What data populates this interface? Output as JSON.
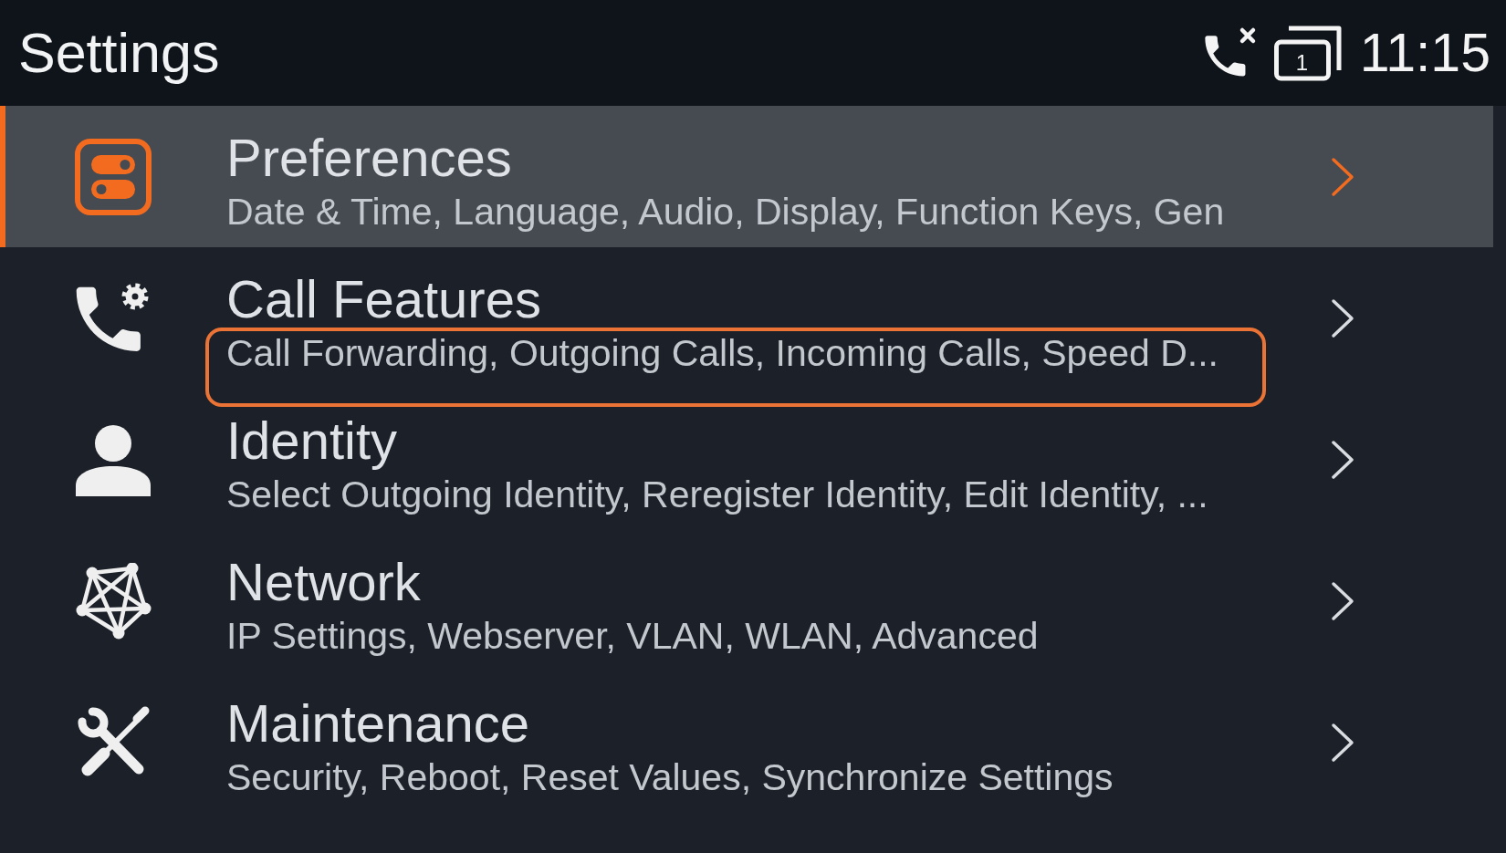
{
  "status_bar": {
    "title": "Settings",
    "account_number": "1",
    "time": "11:15"
  },
  "items": [
    {
      "title": "Preferences",
      "subtitle": "Date & Time, Language, Audio, Display, Function Keys, Gen",
      "selected": true,
      "highlighted": false
    },
    {
      "title": "Call Features",
      "subtitle": "Call Forwarding, Outgoing Calls, Incoming Calls, Speed D...",
      "selected": false,
      "highlighted": true
    },
    {
      "title": "Identity",
      "subtitle": "Select Outgoing Identity, Reregister Identity, Edit Identity, ...",
      "selected": false,
      "highlighted": false
    },
    {
      "title": "Network",
      "subtitle": "IP Settings, Webserver, VLAN, WLAN, Advanced",
      "selected": false,
      "highlighted": false
    },
    {
      "title": "Maintenance",
      "subtitle": "Security, Reboot, Reset Values, Synchronize Settings",
      "selected": false,
      "highlighted": false
    }
  ]
}
